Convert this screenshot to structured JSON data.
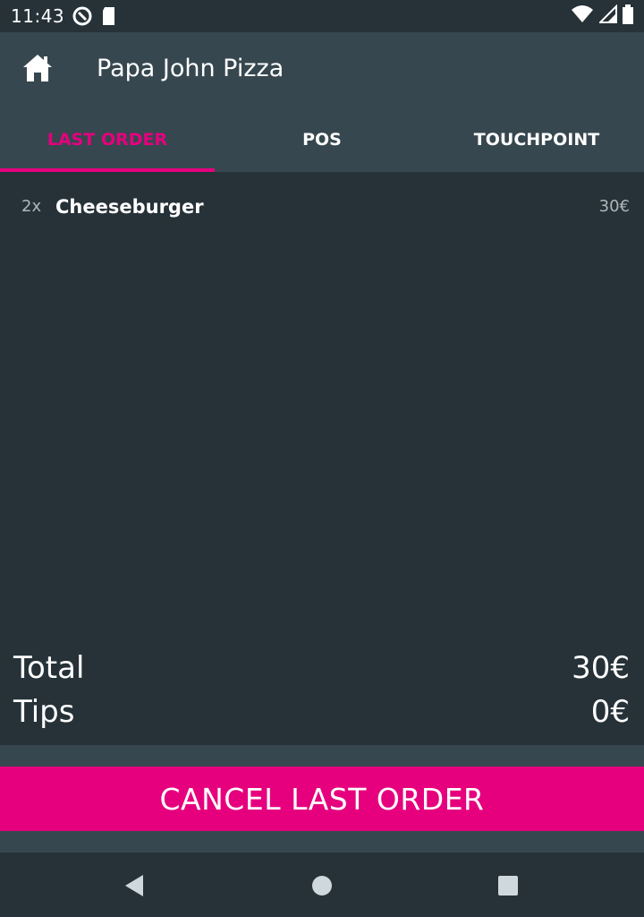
{
  "status_bar": {
    "time": "11:43",
    "left_icons": [
      "at-sign-icon",
      "sd-card-icon"
    ],
    "right_icons": [
      "wifi-icon",
      "cellular-signal-icon",
      "battery-icon"
    ]
  },
  "header": {
    "title": "Papa John Pizza",
    "home_icon": "home-icon"
  },
  "tabs": [
    {
      "label": "LAST ORDER",
      "active": true
    },
    {
      "label": "POS",
      "active": false
    },
    {
      "label": "TOUCHPOINT",
      "active": false
    }
  ],
  "order": {
    "items": [
      {
        "quantity": "2x",
        "name": "Cheeseburger",
        "price": "30€"
      }
    ],
    "total_label": "Total",
    "total_value": "30€",
    "tips_label": "Tips",
    "tips_value": "0€"
  },
  "actions": {
    "cancel_label": "CANCEL LAST ORDER"
  },
  "nav_bar": {
    "icons": [
      "back-icon",
      "home-circle-icon",
      "recents-icon"
    ]
  },
  "colors": {
    "accent": "#e6007e",
    "header_background": "#37474f",
    "content_background": "#263238"
  }
}
